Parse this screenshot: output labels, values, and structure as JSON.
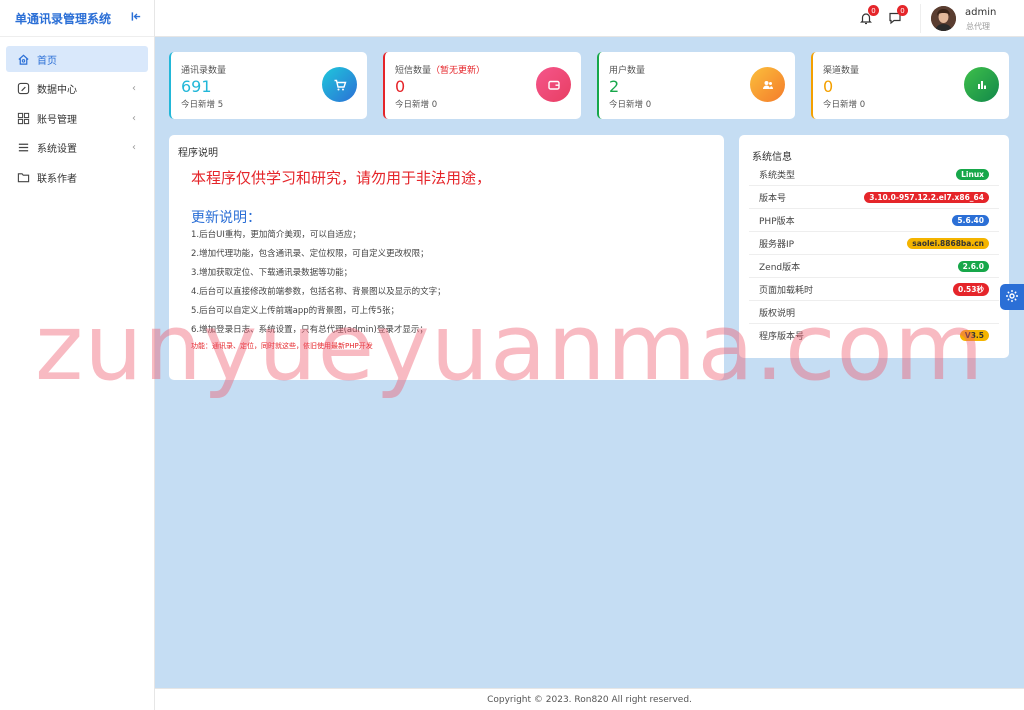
{
  "app": {
    "title": "单通讯录管理系统"
  },
  "colors": {
    "accent": "#2b6fd6",
    "danger": "#e5252a",
    "success": "#17a74a",
    "warning": "#f4b400",
    "cyan": "#22b7d8"
  },
  "sidebar": {
    "items": [
      {
        "label": "首页",
        "icon": "home-icon",
        "active": true
      },
      {
        "label": "数据中心",
        "icon": "edit-icon",
        "has_arrow": true
      },
      {
        "label": "账号管理",
        "icon": "grid-icon",
        "has_arrow": true
      },
      {
        "label": "系统设置",
        "icon": "list-icon",
        "has_arrow": true
      },
      {
        "label": "联系作者",
        "icon": "folder-icon"
      }
    ]
  },
  "header": {
    "notifications": {
      "icon": "bell-icon",
      "count": "0"
    },
    "messages": {
      "icon": "chat-icon",
      "count": "0"
    },
    "user": {
      "name": "admin",
      "role": "总代理"
    }
  },
  "stats": [
    {
      "label": "通讯录数量",
      "value": "691",
      "sub": "今日新增 5",
      "color": "#22b7d8",
      "icon": "cart-icon"
    },
    {
      "label": "短信数量",
      "note": "（暂无更新）",
      "value": "0",
      "sub": "今日新增 0",
      "color": "#e5252a",
      "icon": "wallet-icon"
    },
    {
      "label": "用户数量",
      "value": "2",
      "sub": "今日新增 0",
      "color": "#17a74a",
      "icon": "users-icon"
    },
    {
      "label": "渠道数量",
      "value": "0",
      "sub": "今日新增 0",
      "color": "#f4a000",
      "icon": "bar-chart-icon"
    }
  ],
  "program": {
    "title": "程序说明",
    "warning": "本程序仅供学习和研究，请勿用于非法用途，",
    "update_title": "更新说明：",
    "lines": [
      "1.后台UI重构，更加简介美观，可以自适应；",
      "2.增加代理功能，包含通讯录、定位权限，可自定义更改权限；",
      "3.增加获取定位、下载通讯录数据等功能；",
      "4.后台可以直接修改前端参数，包括名称、背景图以及显示的文字；",
      "5.后台可以自定义上传前端app的背景图，可上传5张；",
      "6.增加登录日志、系统设置，只有总代理(admin)登录才显示；"
    ],
    "note": "功能：通讯录、定位，同时就这些，依旧使用最新PHP开发"
  },
  "system": {
    "title": "系统信息",
    "rows": [
      {
        "key": "系统类型",
        "value": "Linux",
        "color": "#17a74a"
      },
      {
        "key": "版本号",
        "value": "3.10.0-957.12.2.el7.x86_64",
        "color": "#e5252a"
      },
      {
        "key": "PHP版本",
        "value": "5.6.40",
        "color": "#2b6fd6"
      },
      {
        "key": "服务器IP",
        "value": "saolei.8868ba.cn",
        "color": "#f4b400"
      },
      {
        "key": "Zend版本",
        "value": "2.6.0",
        "color": "#17a74a"
      },
      {
        "key": "页面加载耗时",
        "value": "0.53秒",
        "color": "#e5252a"
      },
      {
        "key": "版权说明",
        "value": ""
      },
      {
        "key": "程序版本号",
        "value": "V3.5",
        "color": "#f4b400"
      }
    ]
  },
  "footer": {
    "text": "Copyright © 2023. Ron820 All right reserved."
  },
  "watermark": {
    "text": "zunyueyuanma.com"
  }
}
